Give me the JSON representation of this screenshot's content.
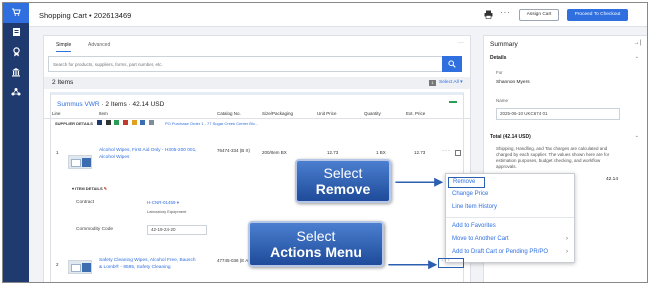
{
  "topbar": {
    "title": "Shopping Cart",
    "cart_id": "202613469",
    "more": "···",
    "assign_label": "Assign Cart",
    "checkout_label": "Proceed To Checkout"
  },
  "tabs": [
    "Simple",
    "Advanced"
  ],
  "tabs_more": "···",
  "search": {
    "placeholder": "Search for products, suppliers, forms, part number, etc."
  },
  "items": {
    "count_label": "2 Items",
    "select_all_count": "1",
    "select_all_label": "Select All"
  },
  "supplier": {
    "name": "Summus VWR",
    "summary": "· 2 Items · 42.14 USD",
    "details_label": "SUPPLIER DETAILS",
    "po_text": "PO Purchase Order 1 - 77 Sugar Creek Center Blv..."
  },
  "columns": [
    "Line",
    "Item",
    "Catalog No.",
    "Size/Packaging",
    "Unit Price",
    "Quantity",
    "Ext. Price"
  ],
  "rows": [
    {
      "line": "1",
      "item": "Alcohol Wipes, First Aid Only - H305-200 001, Alcohol Wipes",
      "catalog": "76474-334 (B X)",
      "size": "200/Item BX",
      "unit_price": "12.73",
      "quantity": "1 BX",
      "ext_price": "12.73"
    },
    {
      "line": "2",
      "item": "Safety Cleaning Wipes, Alcohol Free, Bausch & Lomb® - 8595, Safety Cleaning",
      "catalog": "47745-036 (E A)"
    }
  ],
  "item_details": {
    "label": "ITEM DETAILS",
    "contract_label": "Contract",
    "contract_value": "H-CNR-01459",
    "contract_sub": "Laboratory Equipment",
    "commodity_label": "Commodity Code",
    "commodity_value": "42-19-24-20"
  },
  "summary": {
    "title": "Summary",
    "collapse": "→|",
    "details_title": "Details",
    "for_label": "For",
    "for_value": "Shannon Myers",
    "name_label": "Name",
    "name_value": "2025-06-10 UKC674 01",
    "total_title": "Total (42.14 USD)",
    "total_text": "Shipping, Handling, and Tax charges are calculated and charged by each supplier. The values shown here are for estimation purposes, budget checking, and workflow approvals.",
    "total_amount": "42.14"
  },
  "menu": {
    "items": [
      "Remove",
      "Change Price",
      "Line Item History",
      "Add to Favorites",
      "Move to Another Cart",
      "Add to Draft Cart or Pending PR/PO"
    ]
  },
  "callouts": {
    "remove": {
      "line1": "Select",
      "line2": "Remove"
    },
    "actions": {
      "line1": "Select",
      "line2": "Actions Menu"
    }
  },
  "colors": {
    "sidebar": "#1f3a6e",
    "accent": "#2f6fe0",
    "callout": "#2b5fb0"
  }
}
